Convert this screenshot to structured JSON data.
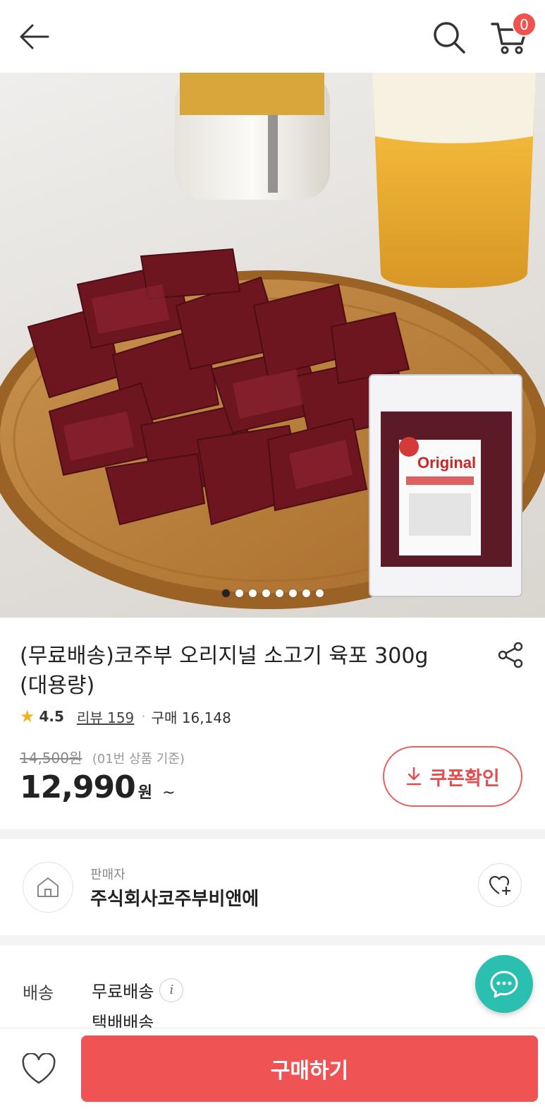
{
  "header": {
    "back_icon": "arrow-left-icon",
    "search_icon": "search-icon",
    "cart_icon": "cart-icon",
    "cart_count": "0",
    "badge_color": "#ef5350"
  },
  "gallery": {
    "image_count": 8,
    "active_index": 0
  },
  "product": {
    "title_line1": "(무료배송)코주부 오리지널 소고기 육포 300g",
    "title_line2": "(대용량)",
    "rating": "4.5",
    "review_label": "리뷰 159",
    "purchase_label": "구매 16,148",
    "original_price": "14,500원",
    "price_note": "(01번 상품 기준)",
    "price": "12,990",
    "price_unit": "원",
    "price_suffix": "~",
    "coupon_label": "쿠폰확인",
    "accent_color": "#e04e4e"
  },
  "seller": {
    "label": "판매자",
    "name": "주식회사코주부비앤에"
  },
  "shipping": {
    "label": "배송",
    "method": "무료배송",
    "info_icon_text": "i",
    "type": "택배배송"
  },
  "footer": {
    "wish_icon": "heart-icon",
    "buy_label": "구매하기",
    "buy_color": "#ef5353",
    "chat_color": "#2bbfaf"
  }
}
